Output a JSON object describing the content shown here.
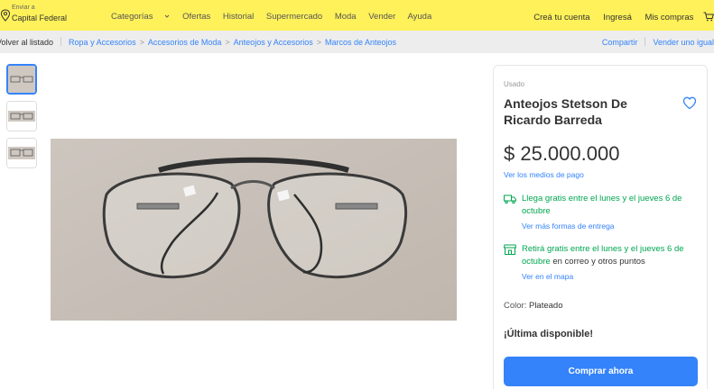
{
  "header": {
    "deliver_label": "Enviar a",
    "deliver_location": "Capital Federal",
    "nav": [
      "Categorías",
      "Ofertas",
      "Historial",
      "Supermercado",
      "Moda",
      "Vender",
      "Ayuda"
    ],
    "account": [
      "Creá tu cuenta",
      "Ingresá",
      "Mis compras"
    ],
    "brand_color": "#fff159"
  },
  "breadcrumb": {
    "back": "Volver al listado",
    "items": [
      "Ropa y Accesorios",
      "Accesorios de Moda",
      "Anteojos y Accesorios",
      "Marcos de Anteojos"
    ],
    "share": "Compartir",
    "sell_similar": "Vender uno igual"
  },
  "product": {
    "condition": "Usado",
    "title": "Anteojos Stetson De Ricardo Barreda",
    "price": "$ 25.000.000",
    "payment_link": "Ver los medios de pago",
    "shipping": {
      "line_green": "Llega gratis",
      "line_rest": "entre el lunes y el jueves 6 de octubre",
      "more_link": "Ver más formas de entrega"
    },
    "pickup": {
      "line_green": "Retirá gratis",
      "line_rest": "entre el lunes y el jueves 6 de octubre",
      "line_tail": "en correo y otros puntos",
      "map_link": "Ver en el mapa"
    },
    "color_label": "Color:",
    "color_value": "Plateado",
    "stock_text": "¡Última disponible!",
    "buy_button": "Comprar ahora",
    "accent_color": "#3483fa",
    "success_color": "#00a650"
  },
  "gallery": {
    "thumb_count": 3,
    "selected_index": 0
  }
}
